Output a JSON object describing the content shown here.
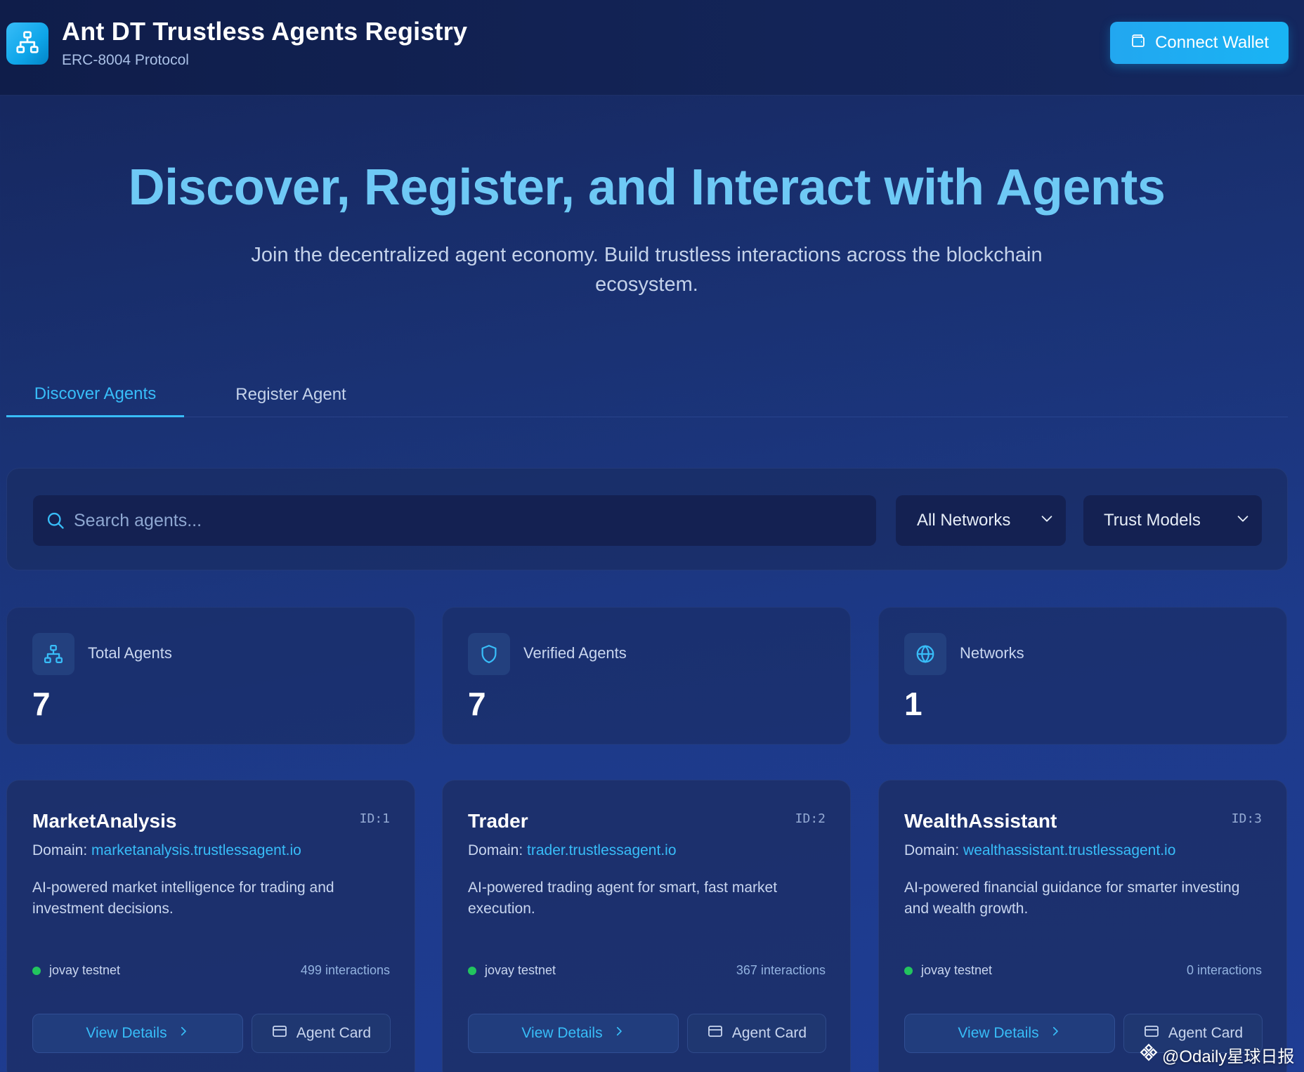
{
  "header": {
    "title": "Ant DT Trustless Agents Registry",
    "subtitle": "ERC-8004 Protocol",
    "logo_icon": "network-hierarchy-icon",
    "connect_wallet_label": "Connect Wallet",
    "connect_wallet_icon": "wallet-icon"
  },
  "hero": {
    "title": "Discover, Register, and Interact with Agents",
    "subtitle": "Join the decentralized agent economy. Build trustless interactions across the blockchain ecosystem."
  },
  "tabs": [
    {
      "label": "Discover Agents",
      "active": true
    },
    {
      "label": "Register Agent",
      "active": false
    }
  ],
  "filters": {
    "search_placeholder": "Search agents...",
    "search_value": "",
    "network_select": "All Networks",
    "trust_select": "Trust Models"
  },
  "stats": [
    {
      "label": "Total Agents",
      "value": "7",
      "icon": "network-hierarchy-icon"
    },
    {
      "label": "Verified Agents",
      "value": "7",
      "icon": "shield-icon"
    },
    {
      "label": "Networks",
      "value": "1",
      "icon": "globe-icon"
    }
  ],
  "agents": [
    {
      "name": "MarketAnalysis",
      "id": "ID:1",
      "domain_label": "Domain:",
      "domain": "marketanalysis.trustlessagent.io",
      "description": "AI-powered market intelligence for trading and investment decisions.",
      "network": "jovay testnet",
      "interactions": "499 interactions",
      "view_label": "View Details",
      "card_label": "Agent Card"
    },
    {
      "name": "Trader",
      "id": "ID:2",
      "domain_label": "Domain:",
      "domain": "trader.trustlessagent.io",
      "description": "AI-powered trading agent for smart, fast market execution.",
      "network": "jovay testnet",
      "interactions": "367 interactions",
      "view_label": "View Details",
      "card_label": "Agent Card"
    },
    {
      "name": "WealthAssistant",
      "id": "ID:3",
      "domain_label": "Domain:",
      "domain": "wealthassistant.trustlessagent.io",
      "description": "AI-powered financial guidance for smarter investing and wealth growth.",
      "network": "jovay testnet",
      "interactions": "0 interactions",
      "view_label": "View Details",
      "card_label": "Agent Card"
    }
  ],
  "watermark": "@Odaily星球日报",
  "colors": {
    "accent": "#38bdf8",
    "status_online": "#22c55e",
    "background": "#1a3274"
  }
}
